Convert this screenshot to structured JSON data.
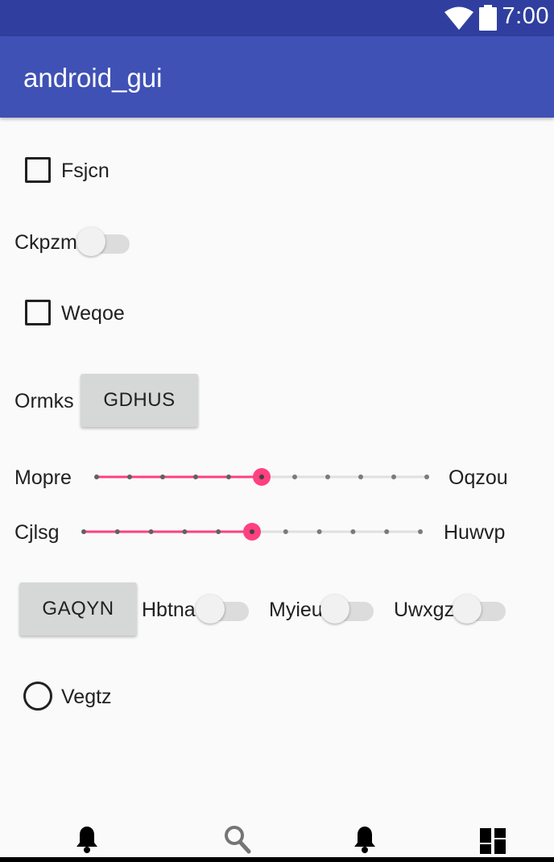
{
  "status_bar": {
    "time": "7:00",
    "icons": [
      "wifi-icon",
      "battery-icon"
    ]
  },
  "app_bar": {
    "title": "android_gui"
  },
  "checkbox_1": {
    "label": "Fsjcn",
    "checked": false
  },
  "switch_1": {
    "label": "Ckpzm",
    "on": false
  },
  "checkbox_2": {
    "label": "Weqoe",
    "checked": false
  },
  "row_button": {
    "label": "Ormks",
    "button": "GDHUS"
  },
  "seekbar_1": {
    "left_label": "Mopre",
    "right_label": "Oqzou",
    "value": 5,
    "max": 10
  },
  "seekbar_2": {
    "left_label": "Cjlsg",
    "right_label": "Huwvp",
    "value": 5,
    "max": 10
  },
  "row_switches": {
    "button": "GAQYN",
    "switches": [
      {
        "label": "Hbtna",
        "on": false
      },
      {
        "label": "Myieu",
        "on": false
      },
      {
        "label": "Uwxgz",
        "on": false
      }
    ]
  },
  "radio_1": {
    "label": "Vegtz",
    "checked": false
  },
  "bottom_nav": {
    "items": [
      "bell-icon",
      "search-icon",
      "bell-icon",
      "dashboard-icon"
    ]
  },
  "colors": {
    "status_bar": "#303f9f",
    "app_bar": "#3f51b5",
    "accent": "#ff4081",
    "background": "#fafafa"
  }
}
